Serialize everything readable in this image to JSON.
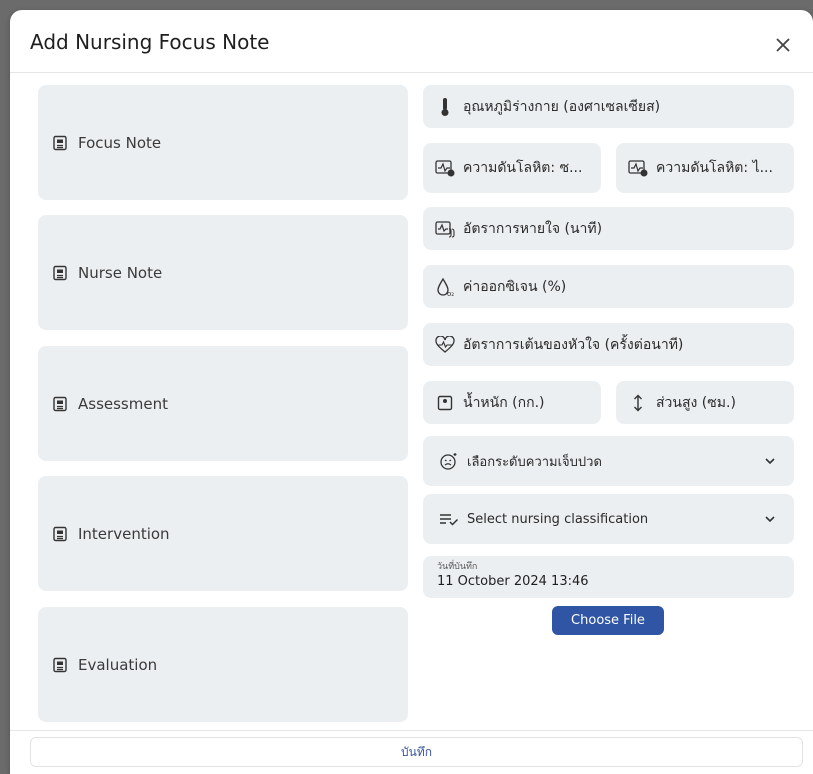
{
  "dialog": {
    "title": "Add Nursing Focus Note",
    "close_icon": "close-icon"
  },
  "left_notes": [
    {
      "label": "Focus Note",
      "icon": "note-icon"
    },
    {
      "label": "Nurse Note",
      "icon": "note-icon"
    },
    {
      "label": "Assessment",
      "icon": "note-icon"
    },
    {
      "label": "Intervention",
      "icon": "note-icon"
    },
    {
      "label": "Evaluation",
      "icon": "note-icon"
    }
  ],
  "vitals": {
    "temperature": {
      "label": "อุณหภูมิร่างกาย (องศาเซลเซียส)",
      "icon": "thermometer-icon"
    },
    "bp_systolic": {
      "label": "ความดันโลหิต: ซ...",
      "icon": "blood-pressure-icon"
    },
    "bp_diastolic": {
      "label": "ความดันโลหิต: ไ...",
      "icon": "blood-pressure-icon"
    },
    "respiratory_rate": {
      "label": "อัตราการหายใจ (นาที)",
      "icon": "lungs-monitor-icon"
    },
    "oxygen": {
      "label": "ค่าออกซิเจน (%)",
      "icon": "oxygen-drop-icon"
    },
    "heart_rate": {
      "label": "อัตราการเต้นของหัวใจ (ครั้งต่อนาที)",
      "icon": "heart-pulse-icon"
    },
    "weight": {
      "label": "น้ำหนัก (กก.)",
      "icon": "scale-icon"
    },
    "height": {
      "label": "ส่วนสูง (ซม.)",
      "icon": "height-arrow-icon"
    }
  },
  "pain_select": {
    "label": "เลือกระดับความเจ็บปวด",
    "icon": "pain-face-icon"
  },
  "classification_select": {
    "label": "Select nursing classification",
    "icon": "list-check-icon"
  },
  "record_date": {
    "label": "วันที่บันทึก",
    "value": "11 October 2024 13:46"
  },
  "choose_file": {
    "label": "Choose File"
  },
  "save": {
    "label": "บันทึก"
  },
  "colors": {
    "field_bg": "#eceff1",
    "primary": "#2f55a4"
  }
}
